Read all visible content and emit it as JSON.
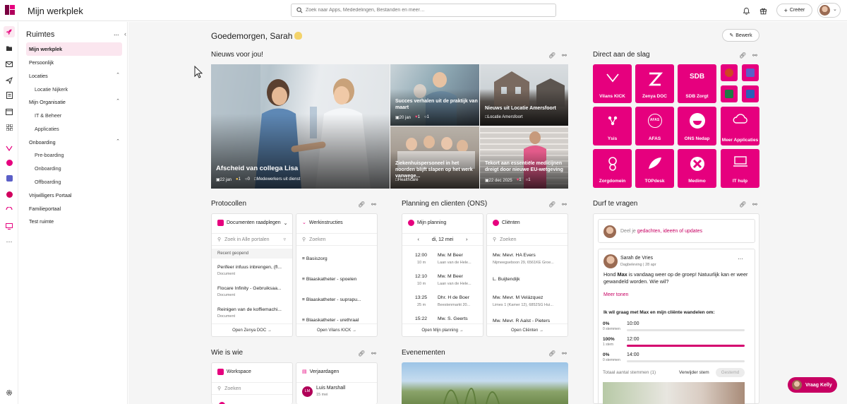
{
  "header": {
    "app_title": "Mijn werkplek",
    "search_placeholder": "Zoek naar Apps, Mededelingen, Bestanden en meer…",
    "create_label": "Creëer"
  },
  "sidebar": {
    "title": "Ruimtes",
    "more": "...",
    "items": [
      {
        "label": "Mijn werkplek"
      },
      {
        "label": "Persoonlijk"
      },
      {
        "label": "Locaties"
      },
      {
        "label": "Locatie Nijkerk"
      },
      {
        "label": "Mijn Organisatie"
      },
      {
        "label": "IT & Beheer"
      },
      {
        "label": "Applicaties"
      },
      {
        "label": "Onboarding"
      },
      {
        "label": "Pre-boarding"
      },
      {
        "label": "Onboarding"
      },
      {
        "label": "Offboarding"
      },
      {
        "label": "Vrijwilligers Portaal"
      },
      {
        "label": "Familieportaal"
      },
      {
        "label": "Test ruimte"
      }
    ]
  },
  "main": {
    "greeting": "Goedemorgen, Sarah",
    "edit_label": "Bewerk"
  },
  "news": {
    "title": "Nieuws voor jou!",
    "items": [
      {
        "title": "Afscheid van collega Lisa",
        "date": "22 jan",
        "likes": "1",
        "comments": "0",
        "category": "Medewerkers uit dienst"
      },
      {
        "title": "Succes verhalen uit de praktijk van maart",
        "date": "20 jan",
        "likes": "1",
        "comments": "1"
      },
      {
        "title": "Nieuws uit Locatie Amersfoort",
        "category": "Locatie Amersfoort"
      },
      {
        "title": "Ziekenhuispersoneel in het noorden blijft slapen op het werk vanwege...",
        "category": "Healthcare"
      },
      {
        "title": "Tekort aan essentiële medicijnen dreigt door nieuwe EU-wetgeving",
        "date": "22 dec 2025",
        "likes": "1",
        "comments": "1"
      }
    ]
  },
  "quick_actions": {
    "title": "Direct aan de slag",
    "tiles": [
      {
        "label": "Vilans KICK"
      },
      {
        "label": "Zenya DOC"
      },
      {
        "label": "SDB Zorgt"
      },
      {
        "label": "Ysis"
      },
      {
        "label": "AFAS"
      },
      {
        "label": "ONS Nedap"
      },
      {
        "label": "Meer Applicaties"
      },
      {
        "label": "Zorgdomein"
      },
      {
        "label": "TOPdesk"
      },
      {
        "label": "Medimo"
      },
      {
        "label": "IT hulp"
      }
    ],
    "icon_sdb": "SDB",
    "icon_afas": "AFAS"
  },
  "protocollen": {
    "title": "Protocollen",
    "docs": {
      "header": "Documenten raadplegen",
      "search": "Zoek in Alle portalen",
      "recent_label": "Recent geopend",
      "rows": [
        {
          "title": "Perifeer infuus inbrengen, (fl...",
          "sub": "Document"
        },
        {
          "title": "Flocare Infinity - Gebruiksaa...",
          "sub": "Document"
        },
        {
          "title": "Reinigen van de koffiemachi...",
          "sub": "Document"
        }
      ],
      "footer": "Open Zenya DOC"
    },
    "werk": {
      "header": "Werkinstructies",
      "search": "Zoeken",
      "rows": [
        "Basiszorg",
        "Blaaskatheter - spoelen",
        "Blaaskatheter - suprapu...",
        "Blaaskatheter - urethraal"
      ],
      "footer": "Open Vilans KICK"
    }
  },
  "planning": {
    "title": "Planning en clienten (ONS)",
    "mijn": {
      "header": "Mijn planning",
      "date": "di, 12 mei",
      "rows": [
        {
          "time": "12:00",
          "dur": "10 m",
          "name": "Mw. M Beer",
          "addr": "Laan van de Hele..."
        },
        {
          "time": "12:10",
          "dur": "10 m",
          "name": "Mw. M Beer",
          "addr": "Laan van de Hele..."
        },
        {
          "time": "13:25",
          "dur": "25 m",
          "name": "Dhr. H de Boer",
          "addr": "Beestenmarkt 20..."
        },
        {
          "time": "15:22",
          "dur": "",
          "name": "Mw. S. Geerts",
          "addr": ""
        }
      ],
      "footer": "Open Mijn planning"
    },
    "clienten": {
      "header": "Cliënten",
      "search": "Zoeken",
      "rows": [
        {
          "name": "Mw. Mevr. HA Evers",
          "addr": "Nijmeegseboon 29, 6561KE Groe..."
        },
        {
          "name": "L. Buijtendijk",
          "addr": ""
        },
        {
          "name": "Mw. Mevr. M Velázquez",
          "addr": "Limes 1 (Kamer 12), 6852SG Hui..."
        },
        {
          "name": "Mw. Mevr. R Aalst - Pieters",
          "addr": ""
        }
      ],
      "footer": "Open Cliënten"
    }
  },
  "vragen": {
    "title": "Durf te vragen",
    "compose_prefix": "Deel je ",
    "compose_rest": "gedachten, ideeën of updates",
    "post": {
      "author": "Sarah de Vries",
      "meta": "Dagbeleving | 28 apr",
      "text_1": "Hond ",
      "text_bold": "Max",
      "text_2": " is vandaag weer op de groep! Natuurlijk kan er weer gewandeld worden. Wie wil?",
      "more": "Meer tonen",
      "poll_question": "Ik wil graag met Max en mijn cliënte wandelen om:",
      "options": [
        {
          "pct": "0%",
          "votes": "0 stemmen",
          "label": "10:00",
          "fraction": 0
        },
        {
          "pct": "100%",
          "votes": "1 stem",
          "label": "12:00",
          "fraction": 1
        },
        {
          "pct": "0%",
          "votes": "0 stemmen",
          "label": "14:00",
          "fraction": 0
        }
      ],
      "total": "Totaal aantal stemmen (1)",
      "remove": "Verwijder stem",
      "voted": "Gestemd"
    }
  },
  "wie": {
    "title": "Wie is wie",
    "workspace": {
      "header": "Workspace",
      "search": "Zoeken"
    },
    "verjaardagen": {
      "header": "Verjaardagen",
      "initials": "LM",
      "name": "Luis Marshall",
      "when": "15 mei"
    }
  },
  "evenementen": {
    "title": "Evenementen"
  },
  "vraag_button": "Vraag Kelly",
  "colors": {
    "brand": "#e6007e",
    "brand_dark": "#c70062",
    "sidebar_active": "#fbe6ef"
  }
}
